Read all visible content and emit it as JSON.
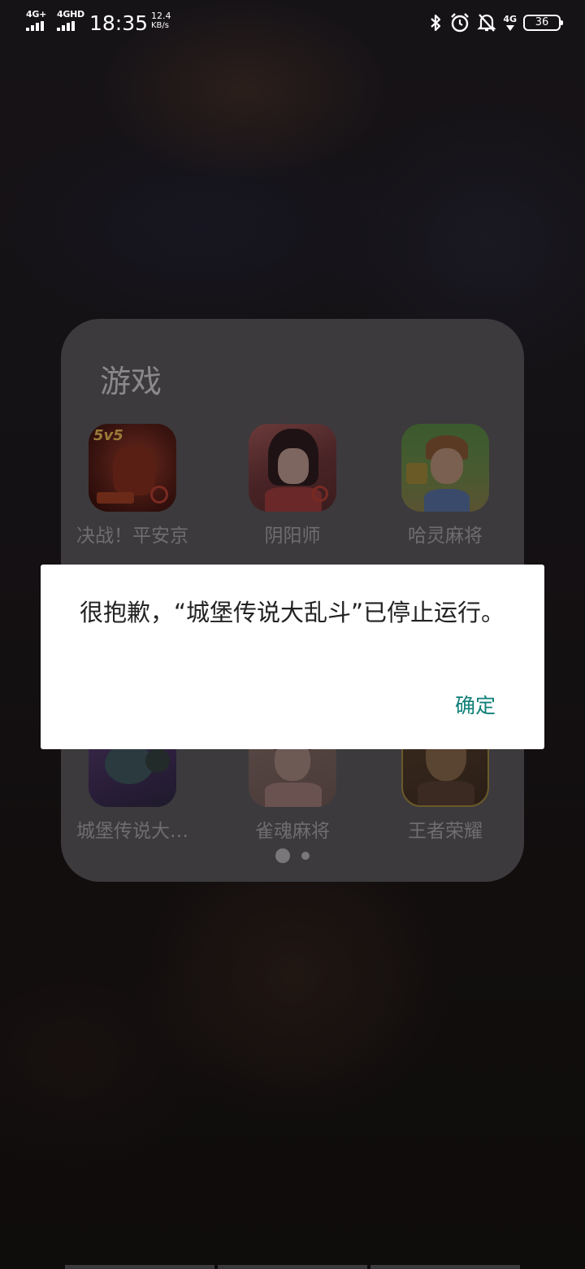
{
  "status_bar": {
    "sim1_network": "4G+",
    "sim2_network": "4GHD",
    "time": "18:35",
    "net_speed_value": "12.4",
    "net_speed_unit": "KB/s",
    "data_network": "4G",
    "battery_level": "36",
    "icons": [
      "bluetooth-icon",
      "alarm-icon",
      "mute-icon",
      "data-arrows-icon",
      "battery-icon"
    ]
  },
  "folder": {
    "title": "游戏",
    "apps": [
      {
        "label": "决战！平安京",
        "icon": "onmyoji-arena-icon",
        "badge": "5v5"
      },
      {
        "label": "阴阳师",
        "icon": "onmyoji-icon"
      },
      {
        "label": "哈灵麻将",
        "icon": "haling-mahjong-icon"
      },
      {
        "label": "城堡传说大…",
        "icon": "castle-legend-icon"
      },
      {
        "label": "雀魂麻将",
        "icon": "mahjong-soul-icon"
      },
      {
        "label": "王者荣耀",
        "icon": "honor-of-kings-icon"
      }
    ],
    "page_count": 2,
    "current_page": 1
  },
  "dialog": {
    "message": "很抱歉，“城堡传说大乱斗”已停止运行。",
    "ok_label": "确定",
    "accent_color": "#0f8078"
  }
}
